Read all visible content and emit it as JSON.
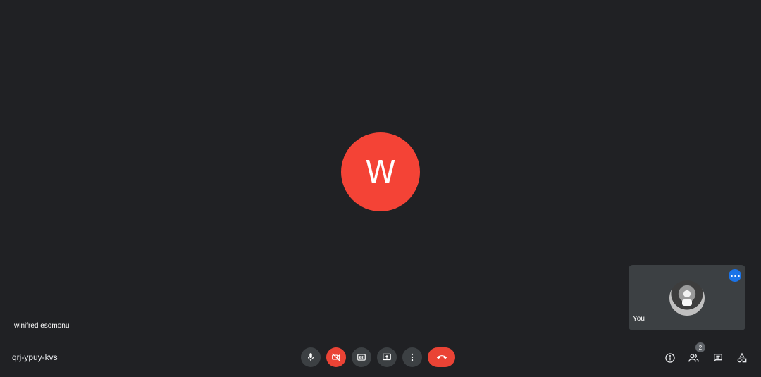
{
  "main": {
    "avatar_initial": "W",
    "avatar_color": "#f44336",
    "presenter_name": "winifred esomonu"
  },
  "self_tile": {
    "label": "You",
    "menu_icon": "more-horiz-icon"
  },
  "footer": {
    "meeting_code": "qrj-ypuy-kvs",
    "controls": [
      {
        "icon": "mic-icon",
        "state": "on"
      },
      {
        "icon": "camera-off-icon",
        "state": "off",
        "color": "#ea4335"
      },
      {
        "icon": "closed-captions-icon"
      },
      {
        "icon": "present-screen-icon"
      },
      {
        "icon": "more-options-icon"
      },
      {
        "icon": "hang-up-icon",
        "color": "#ea4335"
      }
    ],
    "right_icons": [
      {
        "icon": "info-icon"
      },
      {
        "icon": "people-icon",
        "badge": "2"
      },
      {
        "icon": "chat-icon"
      },
      {
        "icon": "activities-icon"
      }
    ]
  }
}
